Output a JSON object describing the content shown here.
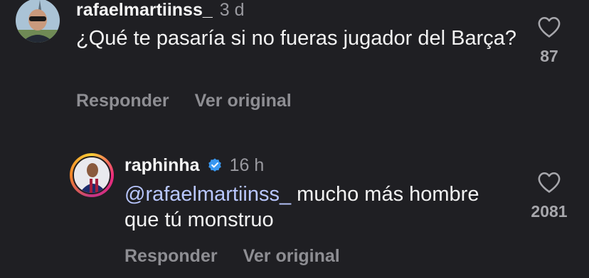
{
  "comments": [
    {
      "username": "rafaelmartiinss_",
      "time": "3 d",
      "text": "¿Qué te pasaría si no fueras jugador del Barça?",
      "reply_label": "Responder",
      "translate_label": "Ver original",
      "likes": "87"
    },
    {
      "username": "raphinha",
      "time": "16 h",
      "mention": "@rafaelmartiinss_",
      "text": " mucho más hombre que tú monstruo",
      "reply_label": "Responder",
      "translate_label": "Ver original",
      "likes": "2081"
    }
  ],
  "icons": {
    "heart": "heart-outline-icon",
    "verified": "verified-badge-icon"
  },
  "colors": {
    "background": "#1f1f23",
    "verified": "#3897f0",
    "mention": "#b9c7ff",
    "muted": "#8e8e93"
  }
}
